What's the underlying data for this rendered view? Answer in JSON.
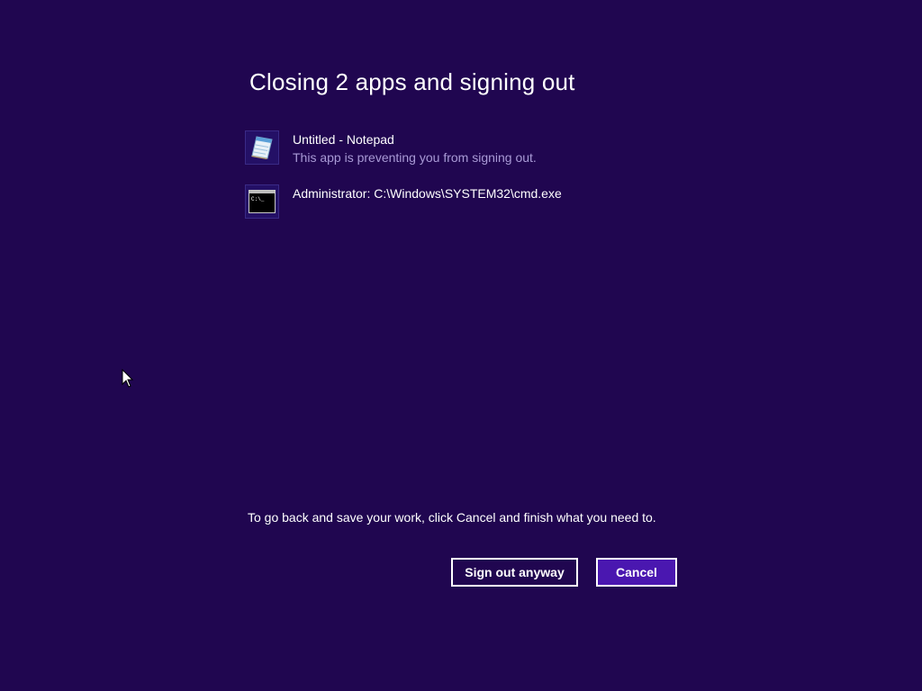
{
  "dialog": {
    "title": "Closing 2 apps and signing out",
    "apps": [
      {
        "name": "Untitled - Notepad",
        "status": "This app is preventing you from signing out.",
        "icon": "notepad-icon"
      },
      {
        "name": "Administrator: C:\\Windows\\SYSTEM32\\cmd.exe",
        "status": "",
        "icon": "cmd-icon",
        "icon_text": "C:\\_"
      }
    ],
    "instruction": "To go back and save your work, click Cancel and finish what you need to.",
    "buttons": {
      "sign_out_anyway": "Sign out anyway",
      "cancel": "Cancel"
    }
  },
  "colors": {
    "background": "#200650",
    "secondary_text": "#a99ad6",
    "cancel_button": "#4a17b0"
  }
}
